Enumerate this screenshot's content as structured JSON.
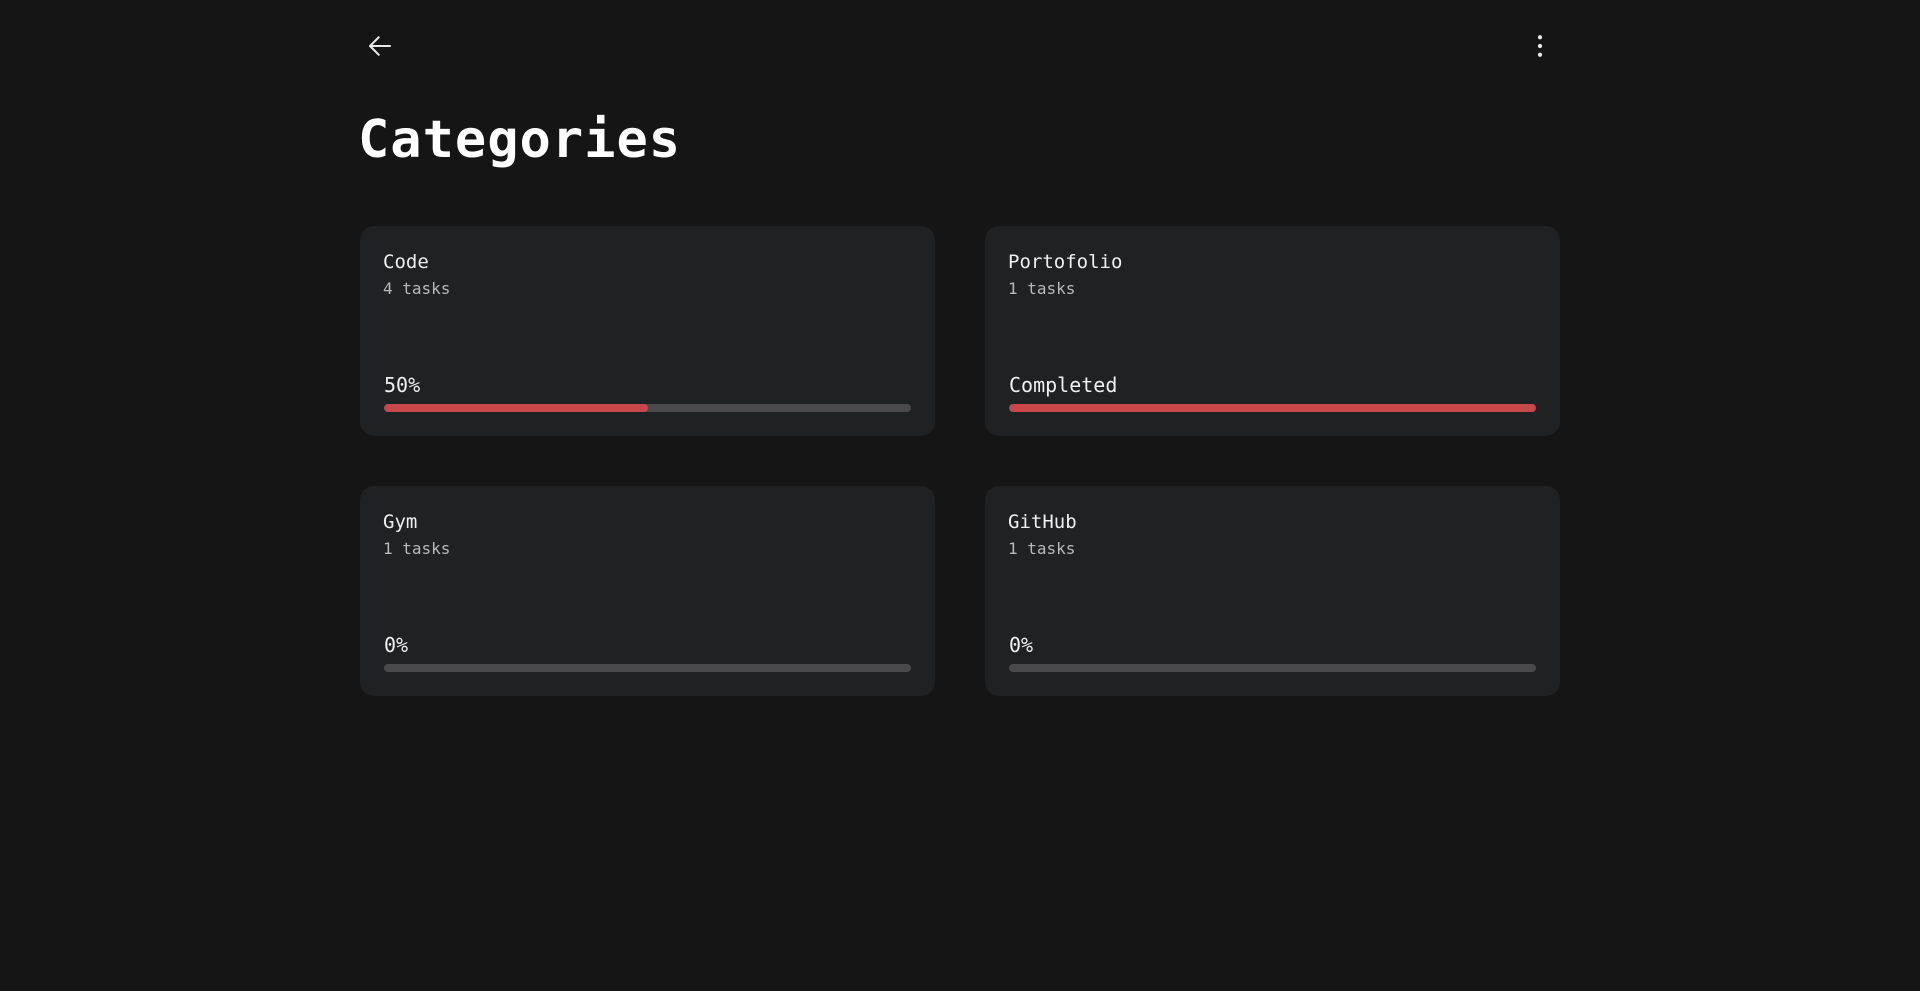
{
  "header": {
    "back_icon": "arrow-left-icon",
    "more_icon": "more-vertical-icon"
  },
  "page_title": "Categories",
  "colors": {
    "background": "#151515",
    "card": "#202123",
    "accent": "#c8474a",
    "track": "#4a4a4c"
  },
  "categories": [
    {
      "name": "Code",
      "count": "4 tasks",
      "progress_label": "50%",
      "progress": 0.5
    },
    {
      "name": "Portofolio",
      "count": "1 tasks",
      "progress_label": "Completed",
      "progress": 1.0
    },
    {
      "name": "Gym",
      "count": "1 tasks",
      "progress_label": "0%",
      "progress": 0
    },
    {
      "name": "GitHub",
      "count": "1 tasks",
      "progress_label": "0%",
      "progress": 0
    }
  ]
}
